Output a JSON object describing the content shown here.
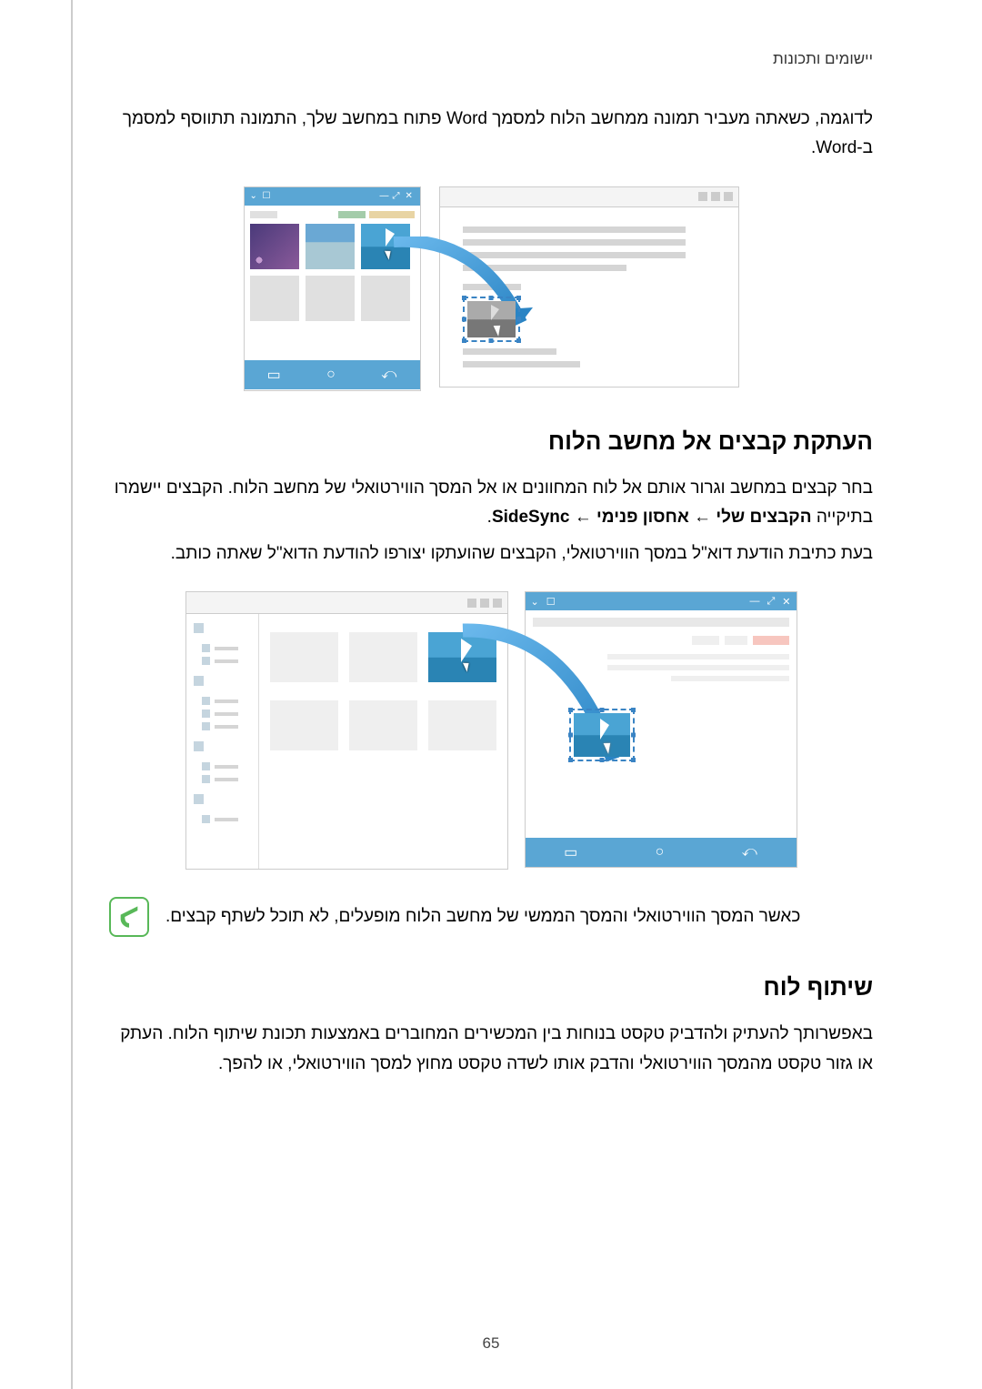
{
  "breadcrumb": "יישומים ותכונות",
  "intro_para": "לדוגמה, כשאתה מעביר תמונה ממחשב הלוח למסמך Word פתוח במחשב שלך, התמונה תתווסף למסמך ב-Word.",
  "section1": {
    "heading": "העתקת קבצים אל מחשב הלוח",
    "para1_prefix": "בחר קבצים במחשב וגרור אותם אל לוח המחוונים או אל המסך הווירטואלי של מחשב הלוח. הקבצים יישמרו בתיקייה ",
    "path_bold": "הקבצים שלי ← אחסון פנימי ← SideSync",
    "path_suffix": ".",
    "para2": "בעת כתיבת הודעת דוא\"ל במסך הווירטואלי, הקבצים שהועתקו יצורפו להודעת הדוא\"ל שאתה כותב."
  },
  "info_note": "כאשר המסך הווירטואלי והמסך הממשי של מחשב הלוח מופעלים, לא תוכל לשתף קבצים.",
  "section2": {
    "heading": "שיתוף לוח",
    "para1": "באפשרותך להעתיק ולהדביק טקסט בנוחות בין המכשירים המחוברים באמצעות תכונת שיתוף הלוח. העתק או גזור טקסט מהמסך הווירטואלי והדבק אותו לשדה טקסט מחוץ למסך הווירטואלי, או להפך."
  },
  "nav_icons": {
    "back": "⤺",
    "home": "○",
    "recent": "▭"
  },
  "page_number": "65"
}
